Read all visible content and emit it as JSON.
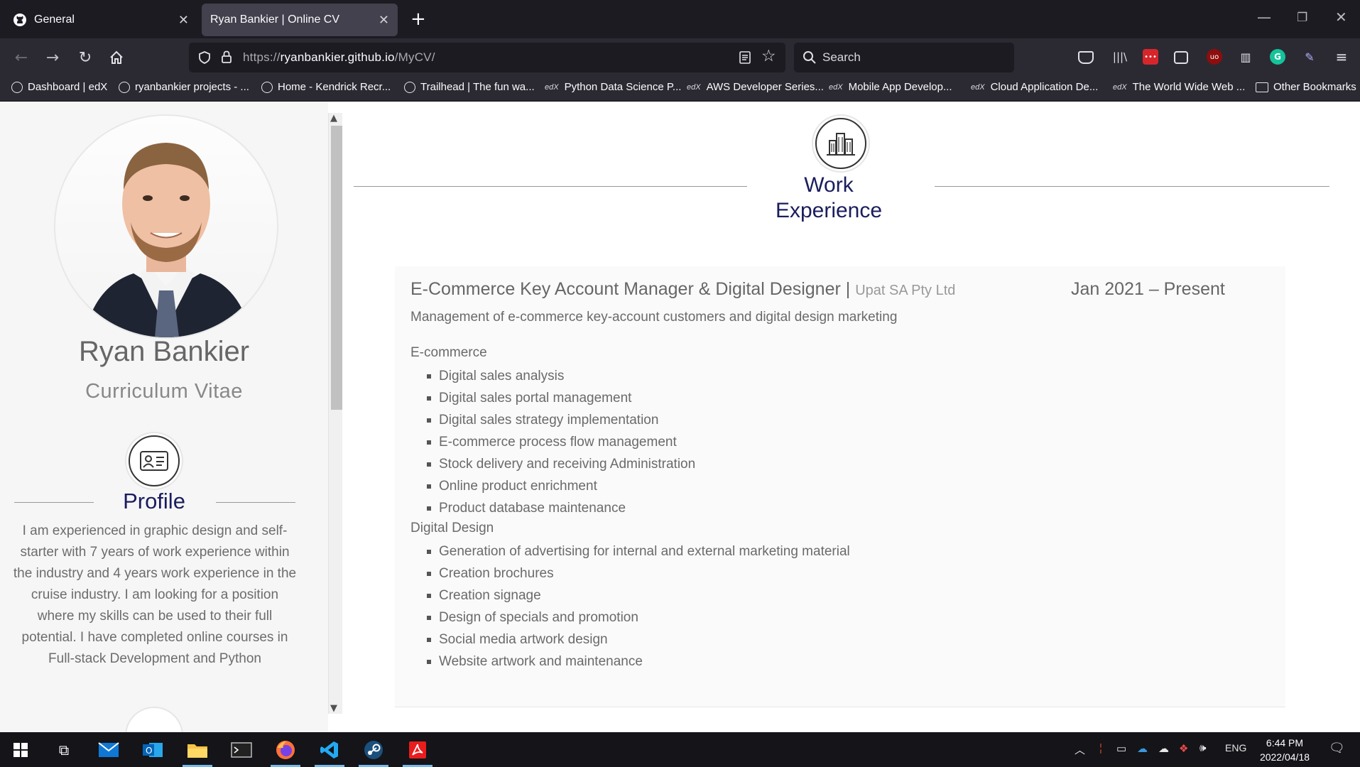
{
  "browser": {
    "tabs": [
      {
        "title": "General"
      },
      {
        "title": "Ryan Bankier | Online CV"
      }
    ],
    "url": {
      "prefix": "https://",
      "host": "ryanbankier.github.io",
      "path": "/MyCV/"
    },
    "search_placeholder": "Search",
    "bookmarks": [
      "Dashboard | edX",
      "ryanbankier projects - ...",
      "Home - Kendrick Recr...",
      "Trailhead | The fun wa...",
      "Python Data Science P...",
      "AWS Developer Series...",
      "Mobile App Develop...",
      "Cloud Application De...",
      "The World Wide Web ...",
      "Other Bookmarks"
    ]
  },
  "profile": {
    "name": "Ryan Bankier",
    "subtitle": "Curriculum Vitae",
    "section_title": "Profile",
    "text": "I am experienced in graphic design and self-starter with 7 years of work experience within the industry and 4 years work experience in the cruise industry. I am looking for a position where my skills can be used to their full potential. I have completed online courses in Full-stack Development and Python"
  },
  "work": {
    "section_title_line1": "Work",
    "section_title_line2": "Experience",
    "job": {
      "role": "E-Commerce Key Account Manager & Digital Designer",
      "separator": "|",
      "company": "Upat SA Pty Ltd",
      "date": "Jan 2021 – Present",
      "description": "Management of e-commerce key-account customers and digital design marketing",
      "categories": [
        {
          "name": "E-commerce",
          "items": [
            "Digital sales analysis",
            "Digital sales portal management",
            "Digital sales strategy implementation",
            "E-commerce process flow management",
            "Stock delivery and receiving Administration",
            "Online product enrichment",
            "Product database maintenance"
          ]
        },
        {
          "name": "Digital Design",
          "items": [
            "Generation of advertising for internal and external marketing material",
            "Creation brochures",
            "Creation signage",
            "Design of specials and promotion",
            "Social media artwork design",
            "Website artwork and maintenance"
          ]
        }
      ]
    }
  },
  "taskbar": {
    "time": "6:44 PM",
    "date": "2022/04/18",
    "language": "ENG"
  }
}
